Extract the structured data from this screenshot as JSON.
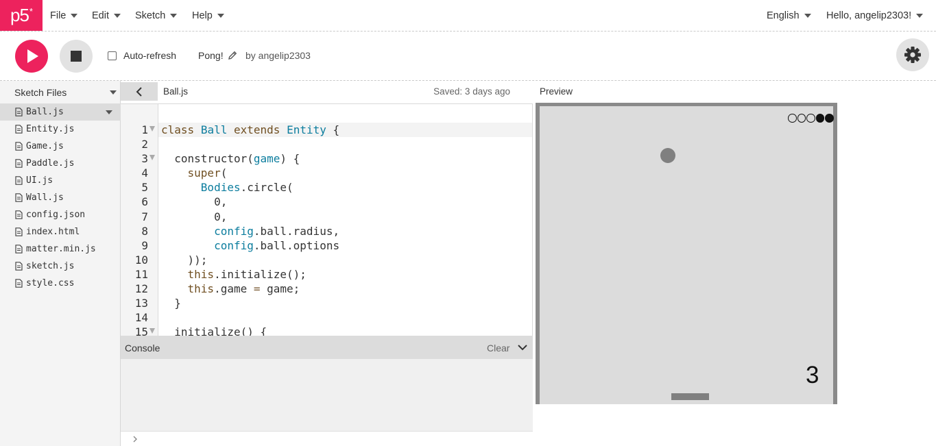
{
  "app": {
    "logo_text": "p5",
    "logo_sup": "*",
    "brand_color": "#ed225d"
  },
  "menu": {
    "file": "File",
    "edit": "Edit",
    "sketch": "Sketch",
    "help": "Help",
    "language": "English",
    "user": "Hello, angelip2303!"
  },
  "toolbar": {
    "auto_refresh": "Auto-refresh",
    "auto_refresh_checked": false,
    "sketch_name": "Pong!",
    "owner": "by angelip2303"
  },
  "sidebar": {
    "title": "Sketch Files",
    "files": [
      "Ball.js",
      "Entity.js",
      "Game.js",
      "Paddle.js",
      "UI.js",
      "Wall.js",
      "config.json",
      "index.html",
      "matter.min.js",
      "sketch.js",
      "style.css"
    ],
    "active": "Ball.js"
  },
  "editor": {
    "filename": "Ball.js",
    "saved": "Saved: 3 days ago",
    "line_numbers": [
      "1",
      "2",
      "3",
      "4",
      "5",
      "6",
      "7",
      "8",
      "9",
      "10",
      "11",
      "12",
      "13",
      "14",
      "15"
    ]
  },
  "console": {
    "title": "Console",
    "clear": "Clear"
  },
  "preview": {
    "label": "Preview",
    "score": "3",
    "lives_total": 5,
    "lives_filled": 2
  }
}
